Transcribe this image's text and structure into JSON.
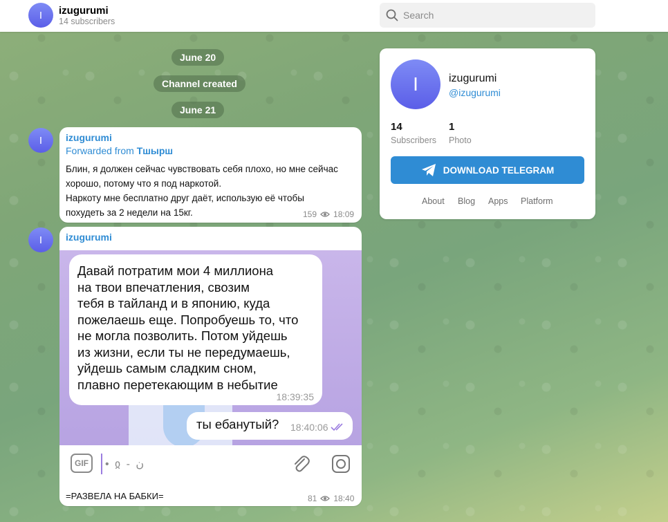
{
  "header": {
    "avatar_letter": "I",
    "channel_name": "izugurumi",
    "subscribers_text": "14 subscribers",
    "search_placeholder": "Search"
  },
  "dates": {
    "first": "June 20",
    "service": "Channel created",
    "second": "June 21"
  },
  "messages": [
    {
      "avatar_letter": "I",
      "author": "izugurumi",
      "forwarded_prefix": "Forwarded from ",
      "forwarded_from": "Тшырш",
      "text": "Блин, я должен сейчас чувствовать себя плохо, но мне сейчас\nхорошо, потому что я под наркотой.\nНаркоту мне бесплатно друг даёт, использую её чтобы\nпохудеть за 2 недели на 15кг.",
      "views": "159",
      "time": "18:09"
    },
    {
      "avatar_letter": "I",
      "author": "izugurumi",
      "photo": {
        "incoming_text": "Давай потратим мои 4 миллиона\nна твои впечатления, свозим\nтебя в тайланд и в японию, куда\nпожелаешь еще. Попробуешь то, что\nне могла позволить. Потом уйдешь\nиз жизни, если ты не передумаешь,\nуйдешь самым сладким сном,\nплавно перетекающим в небытие",
        "incoming_time": "18:39:35",
        "outgoing_text": "ты ебанутый?",
        "outgoing_time": "18:40:06",
        "toolbar_gif": "GIF",
        "toolbar_typed": "• ჲ - ن"
      },
      "caption": "=РАЗВЕЛА НА БАБКИ=",
      "views": "81",
      "time": "18:40"
    }
  ],
  "card": {
    "avatar_letter": "I",
    "name": "izugurumi",
    "handle": "@izugurumi",
    "stats": [
      {
        "value": "14",
        "label": "Subscribers"
      },
      {
        "value": "1",
        "label": "Photo"
      }
    ],
    "download_label": "DOWNLOAD TELEGRAM",
    "links": [
      "About",
      "Blog",
      "Apps",
      "Platform"
    ]
  },
  "colors": {
    "accent": "#2f8cd4",
    "avatar_top": "#7e8bf5",
    "avatar_bottom": "#5b5ee8"
  }
}
